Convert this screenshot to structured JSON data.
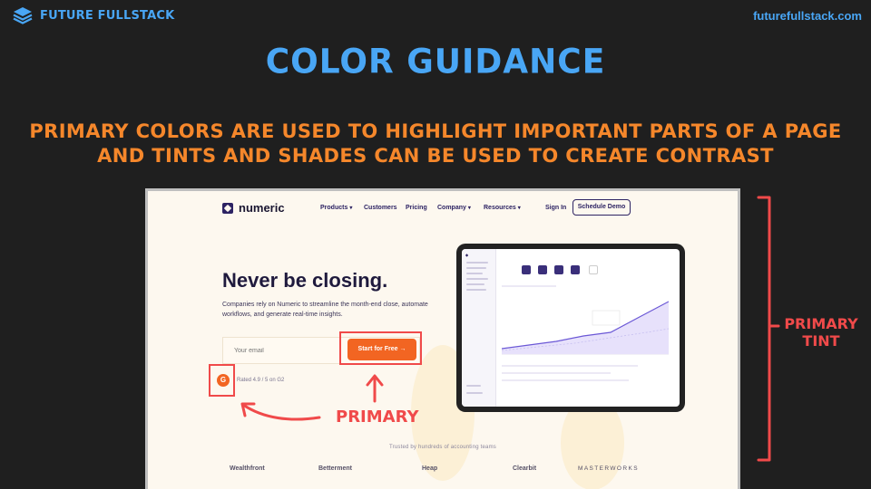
{
  "brand": {
    "name": "FUTURE FULLSTACK",
    "site": "futurefullstack.com",
    "color": "#49a6f5"
  },
  "slide": {
    "title": "COLOR GUIDANCE",
    "subtitle_line1": "PRIMARY COLORS ARE USED TO HIGHLIGHT IMPORTANT PARTS OF A PAGE",
    "subtitle_line2": "AND TINTS AND SHADES CAN BE USED TO CREATE CONTRAST",
    "title_color": "#49a6f5",
    "subtitle_color": "#f5872b"
  },
  "screenshot": {
    "nav": {
      "logo": "numeric",
      "items": [
        "Products",
        "Customers",
        "Pricing",
        "Company",
        "Resources"
      ],
      "sign_in": "Sign In",
      "demo": "Schedule Demo"
    },
    "hero": {
      "title": "Never be closing.",
      "desc": "Companies rely on Numeric to streamline the month-end close, automate workflows, and generate real-time insights.",
      "email_placeholder": "Your email",
      "cta": "Start for Free →",
      "g2_letter": "G",
      "g2_text": "Rated 4.9 / 5 on G2"
    },
    "trusted": "Trusted by hundreds of accounting teams",
    "logos": [
      "Wealthfront",
      "Betterment",
      "Heap",
      "Clearbit",
      "MASTERWORKS"
    ],
    "colors": {
      "primary": "#f26522",
      "tint": "#fdf8ef",
      "shade": "#2d2363"
    }
  },
  "annotations": {
    "primary_label": "PRIMARY",
    "tint_label_line1": "PRIMARY",
    "tint_label_line2": "TINT",
    "color": "#f04a4a"
  }
}
